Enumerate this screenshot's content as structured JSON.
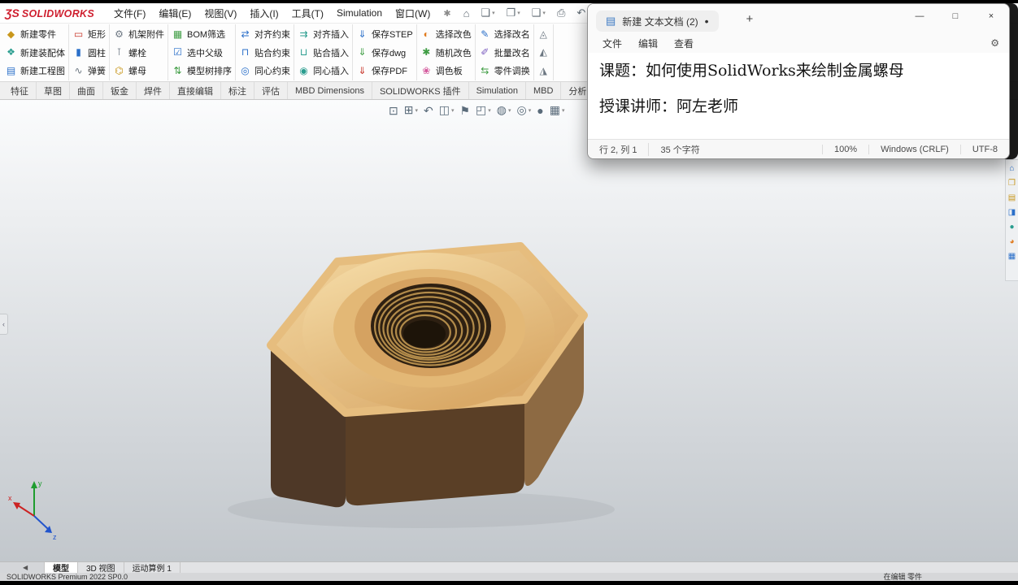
{
  "colors": {
    "brand_red": "#cf1f2f",
    "accent_blue": "#2a6fc9",
    "viewport_top": "#fbfcfd",
    "viewport_bottom": "#c2c7cc",
    "nut_top_light": "#f3d7a0",
    "nut_top_mid": "#e3b876",
    "nut_top_dark": "#d5a261",
    "nut_side_left": "#4e3827",
    "nut_side_front": "#5a3f26",
    "nut_side_right": "#8d6a43",
    "nut_thread": "#c99f55",
    "nut_hole": "#2e2012"
  },
  "menubar": {
    "logo_mark": "ƷS",
    "logo_text": "SOLIDWORKS",
    "menus": [
      "文件(F)",
      "编辑(E)",
      "视图(V)",
      "插入(I)",
      "工具(T)",
      "Simulation",
      "窗口(W)"
    ],
    "pin_glyph": "✱",
    "quick_icons": [
      {
        "icon": "home-icon",
        "glyph": "⌂"
      },
      {
        "icon": "new-document-icon",
        "glyph": "❏"
      },
      {
        "icon": "open-icon",
        "glyph": "❐"
      },
      {
        "icon": "save-icon",
        "glyph": "❑"
      },
      {
        "icon": "print-icon",
        "glyph": "⎙"
      },
      {
        "icon": "undo-icon",
        "glyph": "↶"
      },
      {
        "icon": "redo-icon",
        "glyph": "↷"
      }
    ]
  },
  "toolbar": {
    "groups": [
      {
        "buttons": [
          {
            "icon": "new-part-icon",
            "glyph": "◆",
            "label": "新建零件"
          },
          {
            "icon": "new-assembly-icon",
            "glyph": "❖",
            "label": "新建装配体"
          },
          {
            "icon": "new-drawing-icon",
            "glyph": "▤",
            "label": "新建工程图"
          }
        ]
      },
      {
        "buttons": [
          {
            "icon": "rectangle-icon",
            "glyph": "▭",
            "label": "矩形"
          },
          {
            "icon": "cylinder-icon",
            "glyph": "▮",
            "label": "圆柱"
          },
          {
            "icon": "spring-icon",
            "glyph": "∿",
            "label": "弹簧"
          }
        ]
      },
      {
        "buttons": [
          {
            "icon": "frame-attachment-icon",
            "glyph": "⚙",
            "label": "机架附件"
          },
          {
            "icon": "bolt-icon",
            "glyph": "⊺",
            "label": "螺栓"
          },
          {
            "icon": "nut-icon",
            "glyph": "⌬",
            "label": "螺母"
          }
        ]
      },
      {
        "buttons": [
          {
            "icon": "bom-filter-icon",
            "glyph": "▦",
            "label": "BOM筛选"
          },
          {
            "icon": "select-parent-icon",
            "glyph": "☑",
            "label": "选中父级"
          },
          {
            "icon": "model-tree-sort-icon",
            "glyph": "⇅",
            "label": "模型树排序"
          }
        ]
      },
      {
        "buttons": [
          {
            "icon": "align-mate-icon",
            "glyph": "⇄",
            "label": "对齐约束"
          },
          {
            "icon": "flush-mate-icon",
            "glyph": "⊓",
            "label": "贴合约束"
          },
          {
            "icon": "concentric-mate-icon",
            "glyph": "◎",
            "label": "同心约束"
          }
        ]
      },
      {
        "buttons": [
          {
            "icon": "align-insert-icon",
            "glyph": "⇉",
            "label": "对齐插入"
          },
          {
            "icon": "flush-insert-icon",
            "glyph": "⊔",
            "label": "贴合插入"
          },
          {
            "icon": "concentric-insert-icon",
            "glyph": "◉",
            "label": "同心插入"
          }
        ]
      },
      {
        "buttons": [
          {
            "icon": "save-step-icon",
            "glyph": "⇓",
            "label": "保存STEP"
          },
          {
            "icon": "save-dwg-icon",
            "glyph": "⇓",
            "label": "保存dwg"
          },
          {
            "icon": "save-pdf-icon",
            "glyph": "⇓",
            "label": "保存PDF"
          }
        ]
      },
      {
        "buttons": [
          {
            "icon": "recolor-select-icon",
            "glyph": "◐",
            "label": "选择改色"
          },
          {
            "icon": "recolor-random-icon",
            "glyph": "✱",
            "label": "随机改色"
          },
          {
            "icon": "palette-icon",
            "glyph": "❀",
            "label": "调色板"
          }
        ]
      },
      {
        "buttons": [
          {
            "icon": "rename-select-icon",
            "glyph": "✎",
            "label": "选择改名"
          },
          {
            "icon": "rename-batch-icon",
            "glyph": "✐",
            "label": "批量改名"
          },
          {
            "icon": "part-swap-icon",
            "glyph": "⇆",
            "label": "零件调换"
          }
        ]
      },
      {
        "buttons": [
          {
            "icon": "clipped-icon-1",
            "glyph": "◬",
            "label": ""
          },
          {
            "icon": "clipped-icon-2",
            "glyph": "◭",
            "label": ""
          },
          {
            "icon": "clipped-icon-3",
            "glyph": "◮",
            "label": ""
          }
        ]
      }
    ]
  },
  "ribbon": {
    "tabs": [
      "特征",
      "草图",
      "曲面",
      "钣金",
      "焊件",
      "直接编辑",
      "标注",
      "评估",
      "MBD Dimensions",
      "SOLIDWORKS 插件",
      "Simulation",
      "MBD",
      "分析准备"
    ]
  },
  "hud": {
    "icons": [
      {
        "icon": "zoom-fit-icon",
        "glyph": "⊡"
      },
      {
        "icon": "zoom-area-icon",
        "glyph": "⊞"
      },
      {
        "icon": "previous-view-icon",
        "glyph": "↶"
      },
      {
        "icon": "section-view-icon",
        "glyph": "◫"
      },
      {
        "icon": "annotations-icon",
        "glyph": "⚑"
      },
      {
        "icon": "view-orientation-icon",
        "glyph": "◰"
      },
      {
        "icon": "display-style-icon",
        "glyph": "◍"
      },
      {
        "icon": "hide-show-items-icon",
        "glyph": "◎"
      },
      {
        "icon": "edit-appearance-icon",
        "glyph": "●"
      },
      {
        "icon": "apply-scene-icon",
        "glyph": "▦"
      }
    ]
  },
  "viewport": {
    "triad": {
      "x": "x",
      "y": "y",
      "z": "z"
    }
  },
  "task_pane": {
    "icons": [
      {
        "icon": "resources-icon",
        "glyph": "⌂"
      },
      {
        "icon": "design-library-icon",
        "glyph": "❒"
      },
      {
        "icon": "file-explorer-icon",
        "glyph": "▤"
      },
      {
        "icon": "view-palette-icon",
        "glyph": "◨"
      },
      {
        "icon": "appearances-icon",
        "glyph": "●"
      },
      {
        "icon": "scenes-icon",
        "glyph": "◕"
      },
      {
        "icon": "custom-properties-icon",
        "glyph": "▦"
      }
    ]
  },
  "flyout_glyph": "‹",
  "notepad": {
    "window_icon": "▤",
    "tab_title": "新建 文本文档 (2)",
    "modified_dot": "•",
    "new_tab_glyph": "+",
    "controls": {
      "minimize": "—",
      "maximize": "□",
      "close": "×"
    },
    "menus": [
      "文件",
      "编辑",
      "查看"
    ],
    "settings_icon": "⚙",
    "lines": [
      "课题：如何使用SolidWorks来绘制金属螺母",
      "授课讲师：阿左老师"
    ],
    "status": {
      "cursor": "行 2, 列 1",
      "chars": "35 个字符",
      "zoom": "100%",
      "eol": "Windows (CRLF)",
      "encoding": "UTF-8"
    }
  },
  "bottom_bar": {
    "scroll_glyph": "◀",
    "tabs": [
      "模型",
      "3D 视图",
      "运动算例 1"
    ]
  },
  "status_bar": {
    "product": "SOLIDWORKS Premium 2022 SP0.0",
    "mode": "在编辑 零件"
  }
}
